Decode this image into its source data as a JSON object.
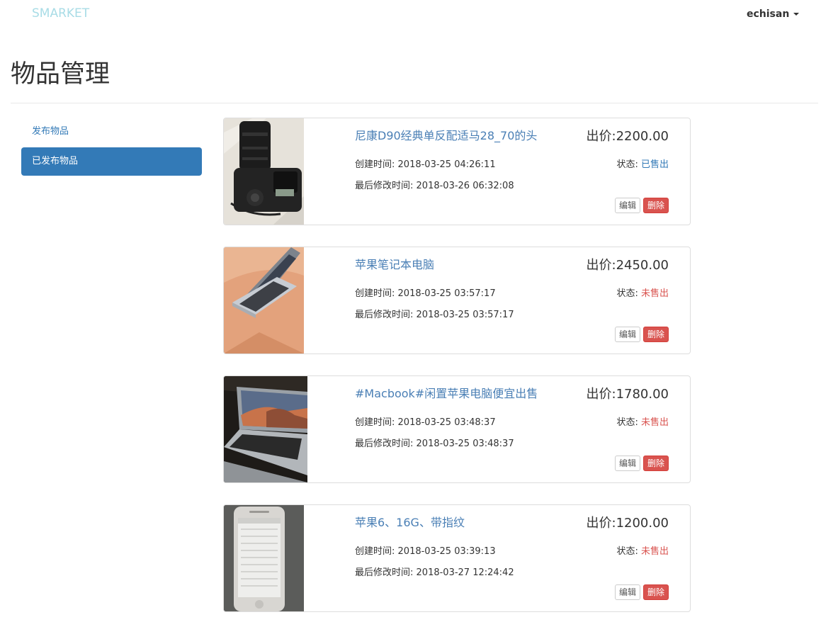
{
  "navbar": {
    "brand": "SMARKET",
    "username": "echisan"
  },
  "page": {
    "title": "物品管理"
  },
  "sidebar": {
    "items": [
      {
        "label": "发布物品"
      },
      {
        "label": "已发布物品"
      }
    ]
  },
  "labels": {
    "price_prefix": "出价:",
    "created_prefix": "创建时间:",
    "modified_prefix": "最后修改时间:",
    "status_prefix": "状态:",
    "edit": "编辑",
    "delete": "删除"
  },
  "items": [
    {
      "title": "尼康D90经典单反配适马28_70的头",
      "price": "2200.00",
      "created": "2018-03-25 04:26:11",
      "modified": "2018-03-26 06:32:08",
      "status": "已售出",
      "status_key": "sold",
      "photo": "camera"
    },
    {
      "title": "苹果笔记本电脑",
      "price": "2450.00",
      "created": "2018-03-25 03:57:17",
      "modified": "2018-03-25 03:57:17",
      "status": "未售出",
      "status_key": "unsold",
      "photo": "laptop-silver"
    },
    {
      "title": "#Macbook#闲置苹果电脑便宜出售",
      "price": "1780.00",
      "created": "2018-03-25 03:48:37",
      "modified": "2018-03-25 03:48:37",
      "status": "未售出",
      "status_key": "unsold",
      "photo": "macbook-dark"
    },
    {
      "title": "苹果6、16G、带指纹",
      "price": "1200.00",
      "created": "2018-03-25 03:39:13",
      "modified": "2018-03-27 12:24:42",
      "status": "未售出",
      "status_key": "unsold",
      "photo": "iphone"
    }
  ]
}
